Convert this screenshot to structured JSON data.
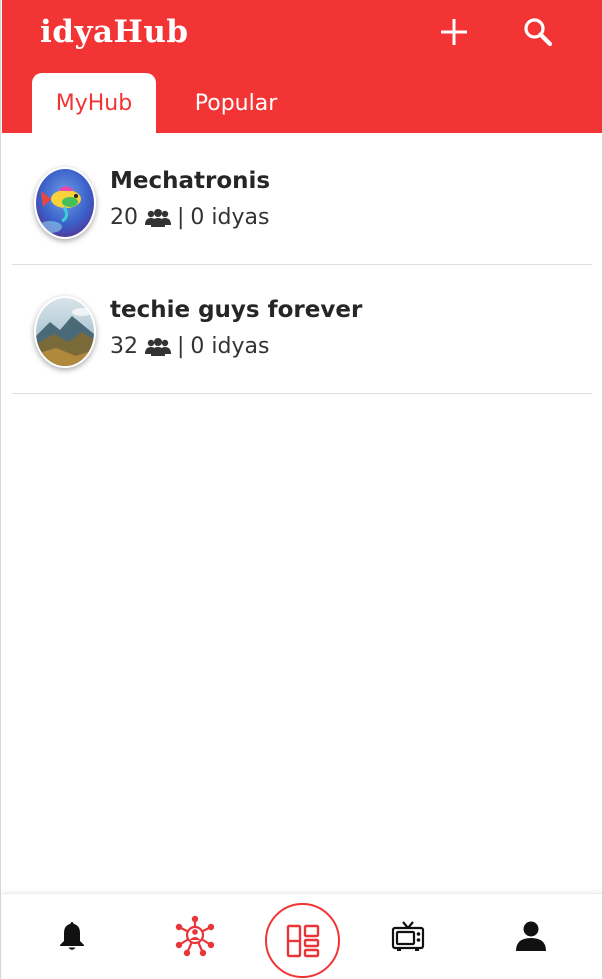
{
  "header": {
    "logo_text": "idyaHub",
    "add_icon": "plus-icon",
    "search_icon": "search-icon",
    "brand_color": "#f23434"
  },
  "tabs": [
    {
      "label": "MyHub",
      "active": true
    },
    {
      "label": "Popular",
      "active": false
    }
  ],
  "groups": [
    {
      "name": "Mechatronis",
      "members": "20",
      "separator": "|",
      "idyas": "0 idyas",
      "avatar": "colorful-fish-image"
    },
    {
      "name": "techie guys forever",
      "members": "32",
      "separator": "|",
      "idyas": "0 idyas",
      "avatar": "mountain-landscape-image"
    }
  ],
  "bottom_nav": [
    {
      "icon": "bell-icon"
    },
    {
      "icon": "network-icon"
    },
    {
      "icon": "dashboard-icon",
      "primary": true
    },
    {
      "icon": "tv-icon"
    },
    {
      "icon": "person-icon"
    }
  ]
}
